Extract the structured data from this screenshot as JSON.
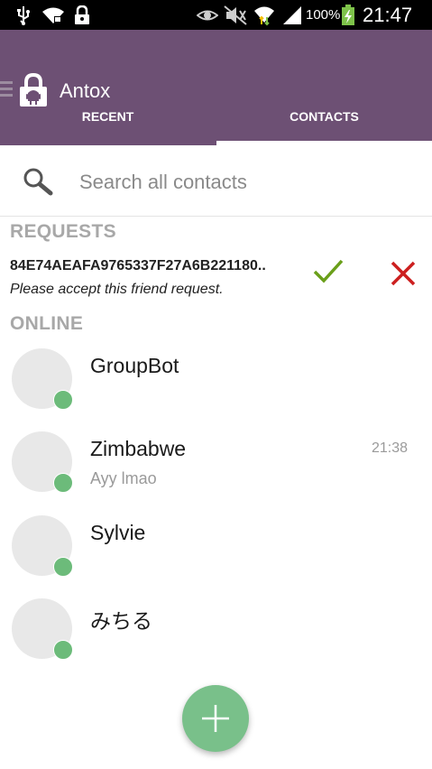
{
  "status_bar": {
    "battery": "100%",
    "time": "21:47",
    "icons": [
      "usb-icon",
      "wifi-locked-icon",
      "lock-icon",
      "eye-icon",
      "mute-icon",
      "wifi-icon",
      "signal-icon",
      "battery-charging-icon"
    ]
  },
  "app_bar": {
    "title": "Antox",
    "icons": [
      "menu-icon",
      "antox-logo-icon"
    ],
    "tabs": [
      {
        "label": "RECENT",
        "selected": false
      },
      {
        "label": "CONTACTS",
        "selected": true
      }
    ]
  },
  "search": {
    "placeholder": "Search all contacts",
    "icon": "search-icon"
  },
  "requests": {
    "header": "REQUESTS",
    "items": [
      {
        "key": "84E74AEAFA9765337F27A6B221180..",
        "message": "Please accept this friend request.",
        "accept_icon": "checkmark-icon",
        "reject_icon": "close-icon"
      }
    ]
  },
  "online": {
    "header": "ONLINE",
    "contacts": [
      {
        "name": "GroupBot",
        "message": "",
        "time": "",
        "status": "online"
      },
      {
        "name": "Zimbabwe",
        "message": "Ayy lmao",
        "time": "21:38",
        "status": "online"
      },
      {
        "name": "Sylvie",
        "message": "",
        "time": "",
        "status": "online"
      },
      {
        "name": "みちる",
        "message": "",
        "time": "",
        "status": "online"
      }
    ]
  },
  "fab": {
    "icon": "add-icon"
  },
  "colors": {
    "app_bar": "#6d5074",
    "status_online": "#6cbb7a",
    "accept": "#6a9f1a",
    "reject": "#cc1f1f",
    "fab": "#79c08a"
  }
}
